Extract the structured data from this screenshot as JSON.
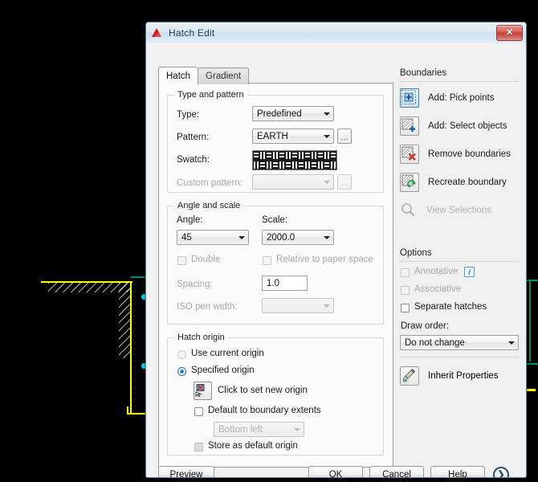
{
  "window": {
    "title": "Hatch Edit",
    "app_icon": "autocad-icon",
    "close_label": "✕"
  },
  "tabs": [
    {
      "label": "Hatch",
      "active": true
    },
    {
      "label": "Gradient",
      "active": false
    }
  ],
  "type_and_pattern": {
    "group_label": "Type and pattern",
    "type_label": "Type:",
    "type_value": "Predefined",
    "pattern_label": "Pattern:",
    "pattern_value": "EARTH",
    "pattern_browse": "...",
    "swatch_label": "Swatch:",
    "swatch_pattern": "EARTH",
    "custom_label": "Custom pattern:",
    "custom_value": "",
    "custom_browse": "..."
  },
  "angle_and_scale": {
    "group_label": "Angle and scale",
    "angle_label": "Angle:",
    "angle_value": "45",
    "scale_label": "Scale:",
    "scale_value": "2000.0",
    "double_label": "Double",
    "relative_label": "Relative to paper space",
    "spacing_label": "Spacing:",
    "spacing_value": "1.0",
    "iso_pen_label": "ISO pen width:",
    "iso_pen_value": ""
  },
  "hatch_origin": {
    "group_label": "Hatch origin",
    "use_current_label": "Use current origin",
    "specified_label": "Specified origin",
    "click_set_label": "Click to set new origin",
    "default_extents_label": "Default to boundary extents",
    "extents_value": "Bottom left",
    "store_default_label": "Store as default origin"
  },
  "boundaries": {
    "section_label": "Boundaries",
    "items": [
      {
        "label": "Add: Pick points",
        "icon": "add-pick-points-icon",
        "enabled": true,
        "selected": true
      },
      {
        "label": "Add: Select objects",
        "icon": "add-select-objects-icon",
        "enabled": true,
        "selected": false
      },
      {
        "label": "Remove boundaries",
        "icon": "remove-boundaries-icon",
        "enabled": true,
        "selected": false
      },
      {
        "label": "Recreate boundary",
        "icon": "recreate-boundary-icon",
        "enabled": true,
        "selected": false
      },
      {
        "label": "View Selections",
        "icon": "view-selections-icon",
        "enabled": false,
        "selected": false
      }
    ]
  },
  "options": {
    "section_label": "Options",
    "annotative_label": "Annotative",
    "annotative_info": "i",
    "associative_label": "Associative",
    "separate_label": "Separate hatches",
    "draw_order_label": "Draw order:",
    "draw_order_value": "Do not change"
  },
  "inherit": {
    "label": "Inherit Properties",
    "icon": "inherit-properties-icon"
  },
  "footer": {
    "preview": "Preview",
    "ok": "OK",
    "cancel": "Cancel",
    "help": "Help",
    "expand": "❯"
  },
  "colors": {
    "accent_blue": "#3c7fb1",
    "title_text": "#1b3a55",
    "close_red": "#c33f37",
    "cad_yellow": "#ffff00",
    "cad_cyan": "#00e5ff",
    "cad_green": "#008f6b",
    "dialog_bg": "#f0f0f0",
    "panel_bg": "#fbfbfb"
  }
}
